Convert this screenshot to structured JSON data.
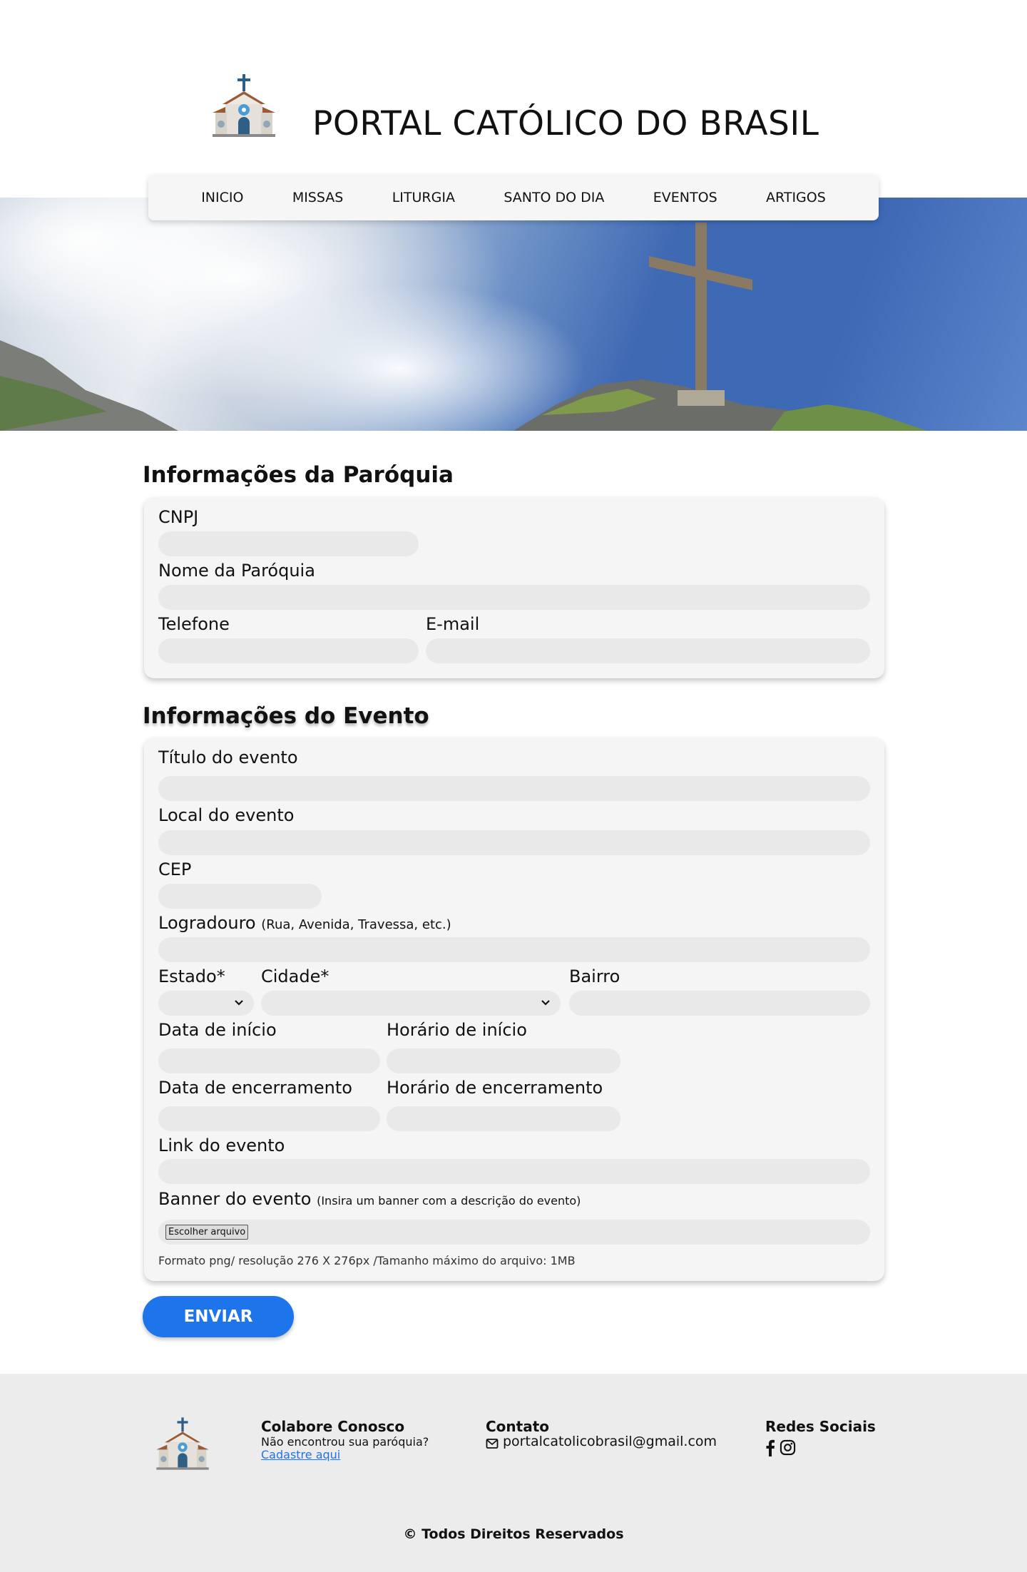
{
  "header": {
    "title": "PORTAL CATÓLICO DO BRASIL",
    "logo_icon": "church-icon"
  },
  "nav": {
    "items": [
      {
        "label": "INICIO"
      },
      {
        "label": "MISSAS"
      },
      {
        "label": "LITURGIA"
      },
      {
        "label": "SANTO DO DIA"
      },
      {
        "label": "EVENTOS"
      },
      {
        "label": "ARTIGOS"
      }
    ]
  },
  "parish": {
    "title": "Informações da Paróquia",
    "cnpj_label": "CNPJ",
    "name_label": "Nome da Paróquia",
    "phone_label": "Telefone",
    "email_label": "E-mail"
  },
  "event": {
    "title": "Informações do Evento",
    "event_title_label": "Título do evento",
    "location_label": "Local do evento",
    "cep_label": "CEP",
    "street_label": "Logradouro",
    "street_hint": "(Rua, Avenida, Travessa, etc.)",
    "state_label": "Estado*",
    "city_label": "Cidade*",
    "district_label": "Bairro",
    "start_date_label": "Data de início",
    "start_time_label": "Horário de início",
    "end_date_label": "Data de encerramento",
    "end_time_label": "Horário de encerramento",
    "link_label": "Link do evento",
    "banner_label": "Banner do evento",
    "banner_hint": "(Insira um banner com a descrição do evento)",
    "file_button": "Escolher arquivo",
    "format_hint": "Formato png/ resolução 276 X 276px /Tamanho máximo do arquivo: 1MB"
  },
  "submit_label": "ENVIAR",
  "footer": {
    "collab_title": "Colabore Conosco",
    "collab_text": "Não encontrou sua paróquia?",
    "collab_link": "Cadastre aqui",
    "contact_title": "Contato",
    "contact_email": "portalcatolicobrasil@gmail.com",
    "social_title": "Redes Sociais",
    "copyright": "© Todos Direitos Reservados"
  },
  "colors": {
    "accent": "#1e74ea",
    "card_bg": "#f5f5f5",
    "field_bg": "#e9e9e9",
    "footer_bg": "#ececec"
  }
}
